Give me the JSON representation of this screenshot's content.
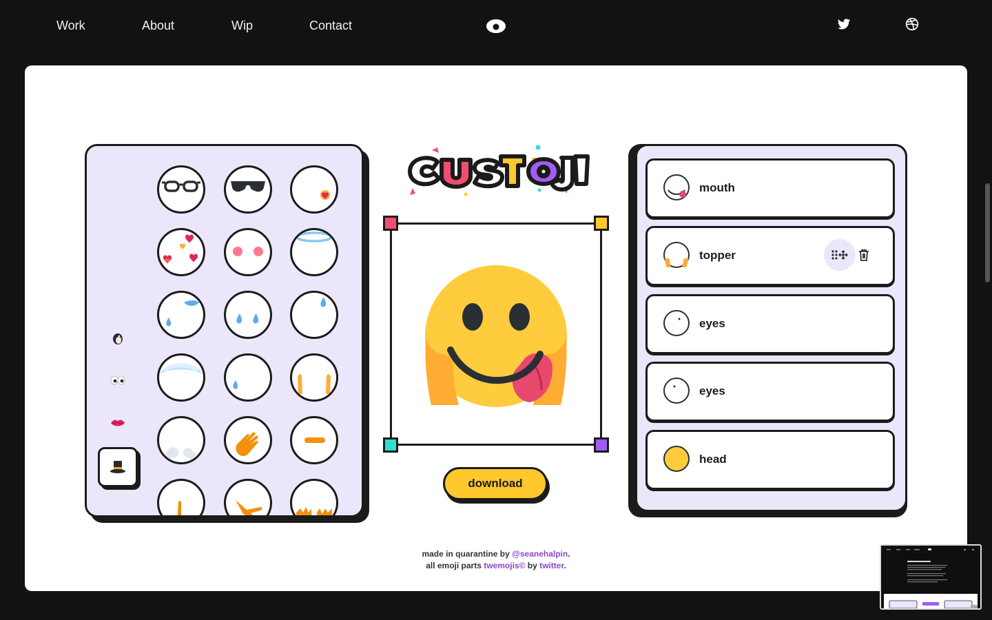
{
  "nav": {
    "links": [
      "Work",
      "About",
      "Wip",
      "Contact"
    ],
    "logo_icon": "eye-icon",
    "social": [
      "twitter-icon",
      "dribbble-icon"
    ]
  },
  "app": {
    "title": "CUSTOJI",
    "categories": [
      "penguin-icon",
      "eyes-icon",
      "lips-icon",
      "top-hat-icon"
    ],
    "active_category": "top-hat-icon",
    "parts": [
      "glasses",
      "sunglasses",
      "heart-cheek",
      "floating-hearts",
      "pink-cheeks",
      "halo",
      "tears-left",
      "tears-both",
      "tear-right",
      "cap",
      "single-tear",
      "hands-up",
      "cloud-hands",
      "waving-hand",
      "bandage",
      "hand-low",
      "hand-point",
      "hands-spread"
    ],
    "download_label": "download",
    "layers": [
      {
        "label": "mouth",
        "icon": "mouth-layer-icon"
      },
      {
        "label": "topper",
        "icon": "topper-layer-icon"
      },
      {
        "label": "eyes",
        "icon": "eyes-layer-icon"
      },
      {
        "label": "eyes",
        "icon": "eyes-layer-icon"
      },
      {
        "label": "head",
        "icon": "head-layer-icon"
      }
    ]
  },
  "credits": {
    "line1_prefix": "made in quarantine by ",
    "line1_link": "@seanehalpin",
    "line1_suffix": ".",
    "line2_prefix": "all emoji parts ",
    "line2_link": "twemojis©",
    "line2_mid": " by ",
    "line2_link2": "twitter",
    "line2_suffix": "."
  },
  "colors": {
    "accent_yellow": "#ffc82c",
    "panel_lavender": "#ece6fb",
    "handle_red": "#f04e6e",
    "handle_cyan": "#2de0d0",
    "handle_purple": "#a15cf5",
    "link_purple": "#8a48c9"
  }
}
